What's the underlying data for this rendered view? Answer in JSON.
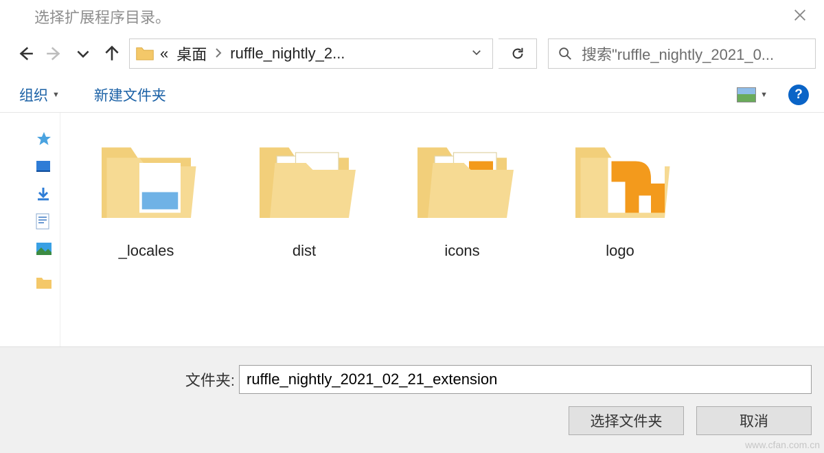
{
  "titlebar": {
    "title": "选择扩展程序目录。"
  },
  "nav": {
    "crumb_prefix": "«",
    "crumb1": "桌面",
    "crumb2": "ruffle_nightly_2...",
    "search_placeholder": "搜索\"ruffle_nightly_2021_0..."
  },
  "toolbar": {
    "organize": "组织",
    "new_folder": "新建文件夹"
  },
  "folders": [
    {
      "name": "_locales",
      "variant": "normal"
    },
    {
      "name": "dist",
      "variant": "open"
    },
    {
      "name": "icons",
      "variant": "orange"
    },
    {
      "name": "logo",
      "variant": "logo"
    }
  ],
  "bottom": {
    "label": "文件夹:",
    "value": "ruffle_nightly_2021_02_21_extension",
    "select": "选择文件夹",
    "cancel": "取消"
  },
  "watermark": "www.cfan.com.cn"
}
